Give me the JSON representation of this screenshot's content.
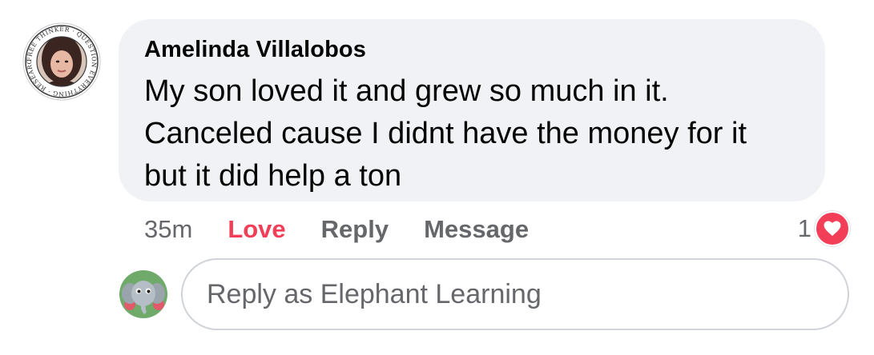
{
  "comment": {
    "author_name": "Amelinda Villalobos",
    "avatar_badge_text": "FREE THINKER · QUESTION EVERYTHING · RESEARCH · INFORM · AWAKE",
    "text_lines": [
      "My son loved it and grew so much in it.",
      "Canceled cause I didnt have the money for it",
      "but it did help a ton"
    ],
    "bubble_color": "#f0f2f5"
  },
  "actions": {
    "timestamp": "35m",
    "love_label": "Love",
    "love_color": "#f33e58",
    "reply_label": "Reply",
    "message_label": "Message"
  },
  "reaction": {
    "count": "1",
    "icon": "heart-icon",
    "color": "#f33e58"
  },
  "reply_box": {
    "placeholder": "Reply as Elephant Learning",
    "page_avatar_icon": "elephant-avatar"
  }
}
